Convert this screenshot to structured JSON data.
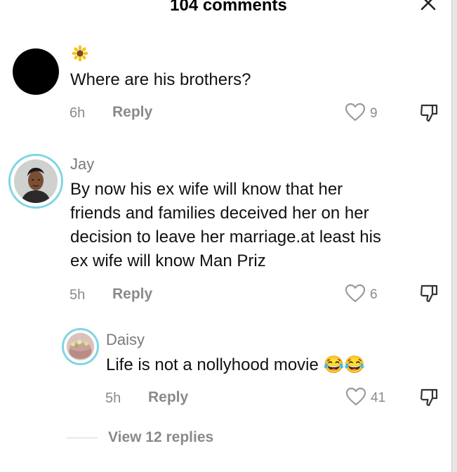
{
  "header": {
    "title": "104 comments",
    "close_icon": "close-icon"
  },
  "comments": [
    {
      "username": "",
      "username_icon": "sunflower-icon",
      "text": "Where are his brothers?",
      "time": "6h",
      "reply_label": "Reply",
      "likes": "9"
    },
    {
      "username": "Jay",
      "text_lines": [
        "By now his ex wife will know that her",
        "friends and families deceived her on her",
        "decision to leave her marriage.at least his",
        "ex wife will know Man Priz"
      ],
      "time": "5h",
      "reply_label": "Reply",
      "likes": "6"
    }
  ],
  "reply": {
    "username": "Daisy",
    "text": "Life is not a nollyhood movie 😂😂",
    "time": "5h",
    "reply_label": "Reply",
    "likes": "41"
  },
  "view_replies_label": "View 12 replies",
  "colors": {
    "accent_ring": "#7fd6e2",
    "muted": "#8a8a8a"
  }
}
